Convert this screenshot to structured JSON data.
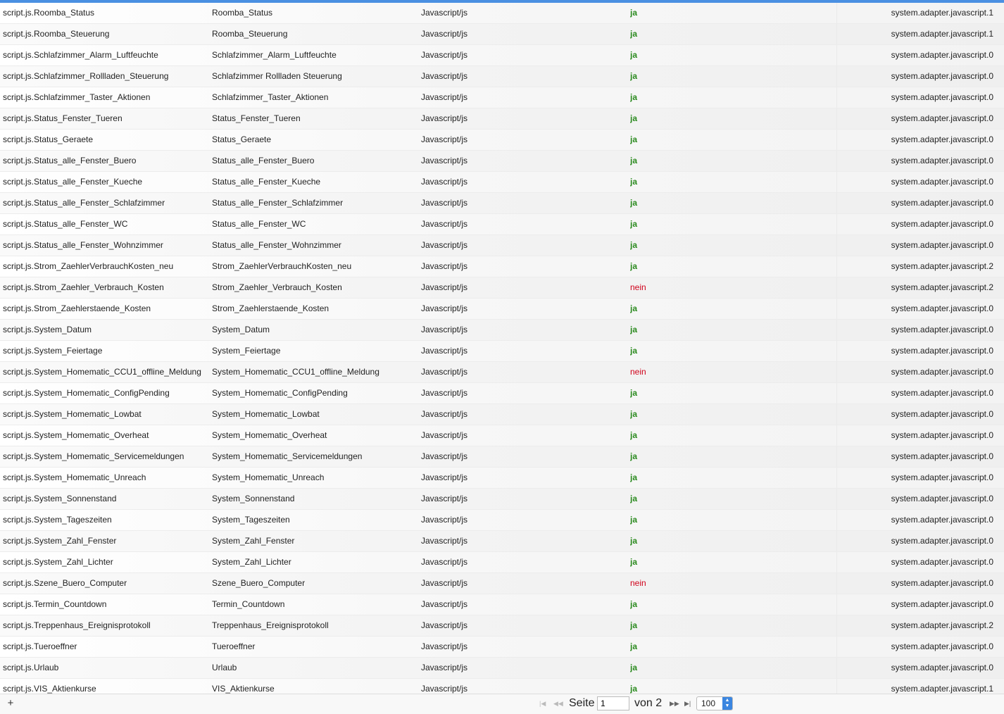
{
  "colors": {
    "accent": "#4a90e2",
    "enabled_yes": "#2a8a1e",
    "enabled_no": "#d0021b"
  },
  "rows": [
    {
      "id": "script.js.Roomba_Status",
      "name": "Roomba_Status",
      "type": "Javascript/js",
      "enabled": "ja",
      "instance": "system.adapter.javascript.1"
    },
    {
      "id": "script.js.Roomba_Steuerung",
      "name": "Roomba_Steuerung",
      "type": "Javascript/js",
      "enabled": "ja",
      "instance": "system.adapter.javascript.1"
    },
    {
      "id": "script.js.Schlafzimmer_Alarm_Luftfeuchte",
      "name": "Schlafzimmer_Alarm_Luftfeuchte",
      "type": "Javascript/js",
      "enabled": "ja",
      "instance": "system.adapter.javascript.0"
    },
    {
      "id": "script.js.Schlafzimmer_Rollladen_Steuerung",
      "name": "Schlafzimmer Rollladen Steuerung",
      "type": "Javascript/js",
      "enabled": "ja",
      "instance": "system.adapter.javascript.0"
    },
    {
      "id": "script.js.Schlafzimmer_Taster_Aktionen",
      "name": "Schlafzimmer_Taster_Aktionen",
      "type": "Javascript/js",
      "enabled": "ja",
      "instance": "system.adapter.javascript.0"
    },
    {
      "id": "script.js.Status_Fenster_Tueren",
      "name": "Status_Fenster_Tueren",
      "type": "Javascript/js",
      "enabled": "ja",
      "instance": "system.adapter.javascript.0"
    },
    {
      "id": "script.js.Status_Geraete",
      "name": "Status_Geraete",
      "type": "Javascript/js",
      "enabled": "ja",
      "instance": "system.adapter.javascript.0"
    },
    {
      "id": "script.js.Status_alle_Fenster_Buero",
      "name": "Status_alle_Fenster_Buero",
      "type": "Javascript/js",
      "enabled": "ja",
      "instance": "system.adapter.javascript.0"
    },
    {
      "id": "script.js.Status_alle_Fenster_Kueche",
      "name": "Status_alle_Fenster_Kueche",
      "type": "Javascript/js",
      "enabled": "ja",
      "instance": "system.adapter.javascript.0"
    },
    {
      "id": "script.js.Status_alle_Fenster_Schlafzimmer",
      "name": "Status_alle_Fenster_Schlafzimmer",
      "type": "Javascript/js",
      "enabled": "ja",
      "instance": "system.adapter.javascript.0"
    },
    {
      "id": "script.js.Status_alle_Fenster_WC",
      "name": "Status_alle_Fenster_WC",
      "type": "Javascript/js",
      "enabled": "ja",
      "instance": "system.adapter.javascript.0"
    },
    {
      "id": "script.js.Status_alle_Fenster_Wohnzimmer",
      "name": "Status_alle_Fenster_Wohnzimmer",
      "type": "Javascript/js",
      "enabled": "ja",
      "instance": "system.adapter.javascript.0"
    },
    {
      "id": "script.js.Strom_ZaehlerVerbrauchKosten_neu",
      "name": "Strom_ZaehlerVerbrauchKosten_neu",
      "type": "Javascript/js",
      "enabled": "ja",
      "instance": "system.adapter.javascript.2"
    },
    {
      "id": "script.js.Strom_Zaehler_Verbrauch_Kosten",
      "name": "Strom_Zaehler_Verbrauch_Kosten",
      "type": "Javascript/js",
      "enabled": "nein",
      "instance": "system.adapter.javascript.2"
    },
    {
      "id": "script.js.Strom_Zaehlerstaende_Kosten",
      "name": "Strom_Zaehlerstaende_Kosten",
      "type": "Javascript/js",
      "enabled": "ja",
      "instance": "system.adapter.javascript.0"
    },
    {
      "id": "script.js.System_Datum",
      "name": "System_Datum",
      "type": "Javascript/js",
      "enabled": "ja",
      "instance": "system.adapter.javascript.0"
    },
    {
      "id": "script.js.System_Feiertage",
      "name": "System_Feiertage",
      "type": "Javascript/js",
      "enabled": "ja",
      "instance": "system.adapter.javascript.0"
    },
    {
      "id": "script.js.System_Homematic_CCU1_offline_Meldung",
      "name": "System_Homematic_CCU1_offline_Meldung",
      "type": "Javascript/js",
      "enabled": "nein",
      "instance": "system.adapter.javascript.0"
    },
    {
      "id": "script.js.System_Homematic_ConfigPending",
      "name": "System_Homematic_ConfigPending",
      "type": "Javascript/js",
      "enabled": "ja",
      "instance": "system.adapter.javascript.0"
    },
    {
      "id": "script.js.System_Homematic_Lowbat",
      "name": "System_Homematic_Lowbat",
      "type": "Javascript/js",
      "enabled": "ja",
      "instance": "system.adapter.javascript.0"
    },
    {
      "id": "script.js.System_Homematic_Overheat",
      "name": "System_Homematic_Overheat",
      "type": "Javascript/js",
      "enabled": "ja",
      "instance": "system.adapter.javascript.0"
    },
    {
      "id": "script.js.System_Homematic_Servicemeldungen",
      "name": "System_Homematic_Servicemeldungen",
      "type": "Javascript/js",
      "enabled": "ja",
      "instance": "system.adapter.javascript.0"
    },
    {
      "id": "script.js.System_Homematic_Unreach",
      "name": "System_Homematic_Unreach",
      "type": "Javascript/js",
      "enabled": "ja",
      "instance": "system.adapter.javascript.0"
    },
    {
      "id": "script.js.System_Sonnenstand",
      "name": "System_Sonnenstand",
      "type": "Javascript/js",
      "enabled": "ja",
      "instance": "system.adapter.javascript.0"
    },
    {
      "id": "script.js.System_Tageszeiten",
      "name": "System_Tageszeiten",
      "type": "Javascript/js",
      "enabled": "ja",
      "instance": "system.adapter.javascript.0"
    },
    {
      "id": "script.js.System_Zahl_Fenster",
      "name": "System_Zahl_Fenster",
      "type": "Javascript/js",
      "enabled": "ja",
      "instance": "system.adapter.javascript.0"
    },
    {
      "id": "script.js.System_Zahl_Lichter",
      "name": "System_Zahl_Lichter",
      "type": "Javascript/js",
      "enabled": "ja",
      "instance": "system.adapter.javascript.0"
    },
    {
      "id": "script.js.Szene_Buero_Computer",
      "name": "Szene_Buero_Computer",
      "type": "Javascript/js",
      "enabled": "nein",
      "instance": "system.adapter.javascript.0"
    },
    {
      "id": "script.js.Termin_Countdown",
      "name": "Termin_Countdown",
      "type": "Javascript/js",
      "enabled": "ja",
      "instance": "system.adapter.javascript.0"
    },
    {
      "id": "script.js.Treppenhaus_Ereignisprotokoll",
      "name": "Treppenhaus_Ereignisprotokoll",
      "type": "Javascript/js",
      "enabled": "ja",
      "instance": "system.adapter.javascript.2"
    },
    {
      "id": "script.js.Tueroeffner",
      "name": "Tueroeffner",
      "type": "Javascript/js",
      "enabled": "ja",
      "instance": "system.adapter.javascript.0"
    },
    {
      "id": "script.js.Urlaub",
      "name": "Urlaub",
      "type": "Javascript/js",
      "enabled": "ja",
      "instance": "system.adapter.javascript.0"
    },
    {
      "id": "script.js.VIS_Aktienkurse",
      "name": "VIS_Aktienkurse",
      "type": "Javascript/js",
      "enabled": "ja",
      "instance": "system.adapter.javascript.1"
    }
  ],
  "pager": {
    "add_icon": "plus-icon",
    "add_label": "+",
    "seite_label": "Seite",
    "current_page": "1",
    "von_label": "von 2",
    "per_page": "100",
    "first_icon": "first-page-icon",
    "prev_icon": "prev-page-icon",
    "next_icon": "next-page-icon",
    "last_icon": "last-page-icon"
  }
}
